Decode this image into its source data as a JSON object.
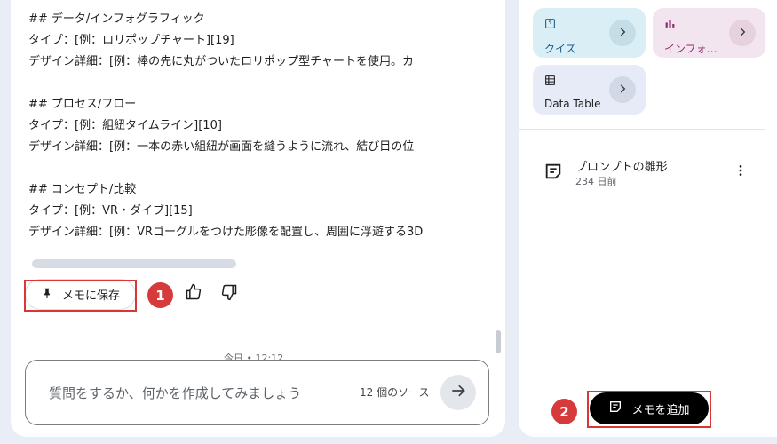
{
  "chat": {
    "lines": [
      "## データ/インフォグラフィック",
      "タイプ：[例：ロリポップチャート][19]",
      "デザイン詳細：[例：棒の先に丸がついたロリポップ型チャートを使用。カ",
      "",
      "## プロセス/フロー",
      "タイプ：[例：組紐タイムライン][10]",
      "デザイン詳細：[例：一本の赤い組紐が画面を縫うように流れ、結び目の位",
      "",
      "## コンセプト/比較",
      "タイプ：[例：VR・ダイブ][15]",
      "デザイン詳細：[例：VRゴーグルをつけた彫像を配置し、周囲に浮遊する3D"
    ],
    "save_note_label": "メモに保存",
    "timestamp": "今日 • 12:12",
    "input_placeholder": "質問をするか、何かを作成してみましょう",
    "source_count": "12 個のソース"
  },
  "markers": {
    "one": "1",
    "two": "2"
  },
  "studio": {
    "cards": [
      {
        "label": "クイズ",
        "icon": "quiz-icon",
        "bg": "#daeff5"
      },
      {
        "label": "インフォ…",
        "icon": "infographic-icon",
        "bg": "#f3e5ef"
      },
      {
        "label": "Data Table",
        "icon": "table-icon",
        "bg": "#e6ebf7"
      }
    ],
    "note": {
      "title": "プロンプトの雛形",
      "date": "234 日前"
    },
    "add_note_label": "メモを追加"
  },
  "colors": {
    "highlight": "#d93636",
    "accent_purple": "#8a2d6a",
    "accent_blue": "#1f5e8c"
  }
}
